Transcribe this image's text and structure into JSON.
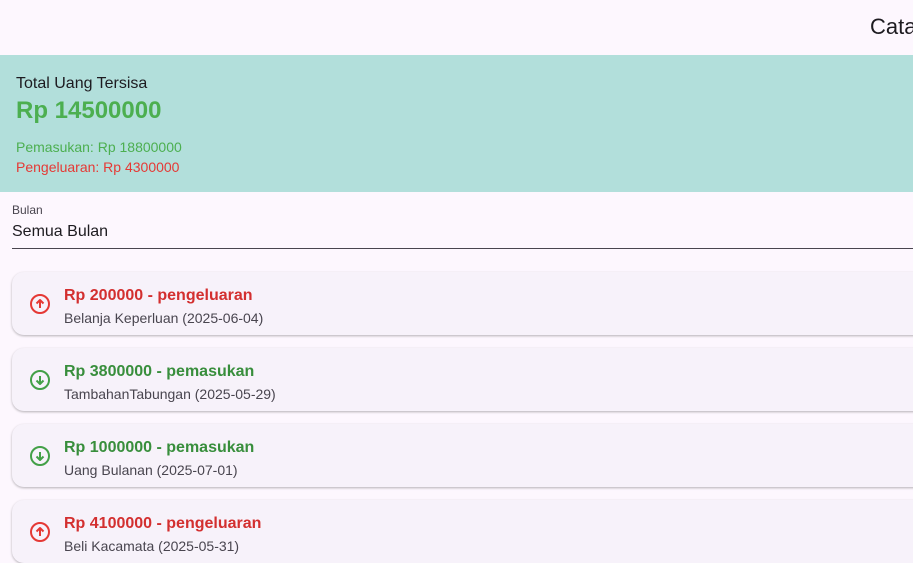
{
  "appbar": {
    "title": "Cata"
  },
  "summary": {
    "label": "Total Uang Tersisa",
    "total": "Rp 14500000",
    "income": "Pemasukan: Rp 18800000",
    "expense": "Pengeluaran: Rp 4300000"
  },
  "filter": {
    "label": "Bulan",
    "value": "Semua Bulan"
  },
  "transactions": [
    {
      "title": "Rp 200000 - pengeluaran",
      "subtitle": "Belanja Keperluan (2025-06-04)",
      "type": "pengeluaran",
      "icon": "arrow-up-circle-icon"
    },
    {
      "title": "Rp 3800000 - pemasukan",
      "subtitle": "TambahanTabungan (2025-05-29)",
      "type": "pemasukan",
      "icon": "arrow-down-circle-icon"
    },
    {
      "title": "Rp 1000000 - pemasukan",
      "subtitle": "Uang Bulanan (2025-07-01)",
      "type": "pemasukan",
      "icon": "arrow-down-circle-icon"
    },
    {
      "title": "Rp 4100000 - pengeluaran",
      "subtitle": "Beli Kacamata (2025-05-31)",
      "type": "pengeluaran",
      "icon": "arrow-up-circle-icon"
    }
  ],
  "colors": {
    "summary_bg": "#b2dfdb",
    "income": "#388e3c",
    "expense": "#d32f2f",
    "background": "#fdf7fe",
    "card": "#f7f2fa"
  }
}
